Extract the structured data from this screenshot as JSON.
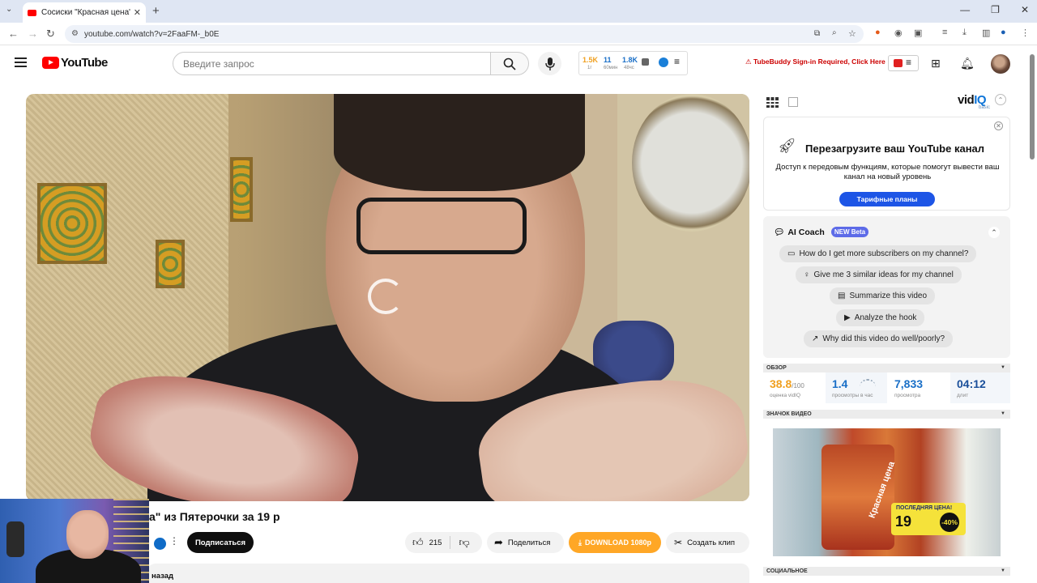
{
  "browser": {
    "tab_title": "Сосиски \"Красная цена\" из Пятерочки за 19 р",
    "url": "youtube.com/watch?v=2FaaFM-_b0E"
  },
  "youtube": {
    "logo_text": "YouTube",
    "search_placeholder": "Введите запрос",
    "vidiq_bar": {
      "stat1": "1.5K",
      "stat1_sub": "1г",
      "stat2": "11",
      "stat2_sub": "60мин",
      "stat3": "1.8K",
      "stat3_sub": "48чс"
    },
    "tubebuddy_warning": "TubeBuddy Sign-in Required, Click Here"
  },
  "video": {
    "title": "а\" из Пятерочки за 19 р",
    "subscribe_label": "Подписаться",
    "likes": "215",
    "share_label": "Поделиться",
    "download_label": "DOWNLOAD 1080p",
    "clip_label": "Создать клип",
    "description_text": "назад"
  },
  "vidiq": {
    "logo_a": "vid",
    "logo_b": "IQ",
    "plan": "basic",
    "promo": {
      "title": "Перезагрузите ваш YouTube канал",
      "description": "Доступ к передовым функциям, которые помогут вывести ваш канал на новый уровень",
      "button": "Тарифные планы"
    },
    "ai_coach": {
      "title": "AI Coach",
      "badge": "NEW Beta",
      "prompts": [
        "How do I get more subscribers on my channel?",
        "Give me 3 similar ideas for my channel",
        "Summarize this video",
        "Analyze the hook",
        "Why did this video do well/poorly?"
      ]
    },
    "sections": {
      "overview": "ОБЗОР",
      "thumbnail": "ЗНАЧОК ВИДЕО",
      "social": "СОЦИАЛЬНОЕ"
    },
    "overview": {
      "score": "38.8",
      "score_max": "/100",
      "score_label": "оценка vidIQ",
      "vph": "1.4",
      "vph_label": "просмотры в час",
      "views": "7,833",
      "views_label": "просмотра",
      "length": "04:12",
      "length_label": "длит"
    },
    "thumbnail": {
      "label_title": "ПОСЛЕДНЯЯ ЦЕНА!",
      "price": "19",
      "discount": "-40%",
      "brand": "Красная цена"
    }
  }
}
